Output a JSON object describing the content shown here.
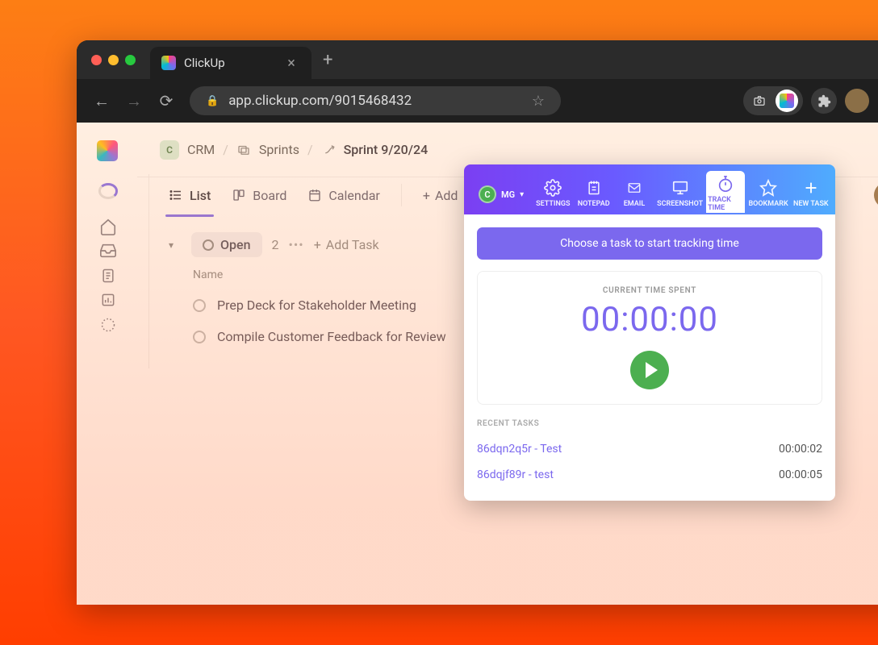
{
  "browser": {
    "tab_title": "ClickUp",
    "url": "app.clickup.com/9015468432"
  },
  "breadcrumb": {
    "workspace_badge": "C",
    "workspace": "CRM",
    "folder": "Sprints",
    "list": "Sprint 9/20/24"
  },
  "views": {
    "list": "List",
    "board": "Board",
    "calendar": "Calendar",
    "add": "Add"
  },
  "task_section": {
    "status": "Open",
    "count": "2",
    "add_task": "Add Task",
    "name_header": "Name",
    "tasks": [
      "Prep Deck for Stakeholder Meeting",
      "Compile Customer Feedback for Review"
    ]
  },
  "popup": {
    "user_badge": "C",
    "user_label": "MG",
    "tabs": {
      "settings": "SETTINGS",
      "notepad": "NOTEPAD",
      "email": "EMAIL",
      "screenshot": "SCREENSHOT",
      "track_time": "TRACK TIME",
      "bookmark": "BOOKMARK",
      "new_task": "NEW TASK"
    },
    "choose_task": "Choose a task to start tracking time",
    "timer_label": "CURRENT TIME SPENT",
    "timer_value": "00:00:00",
    "recent_label": "RECENT TASKS",
    "recent": [
      {
        "name": "86dqn2q5r - Test",
        "time": "00:00:02"
      },
      {
        "name": "86dqjf89r - test",
        "time": "00:00:05"
      }
    ]
  }
}
